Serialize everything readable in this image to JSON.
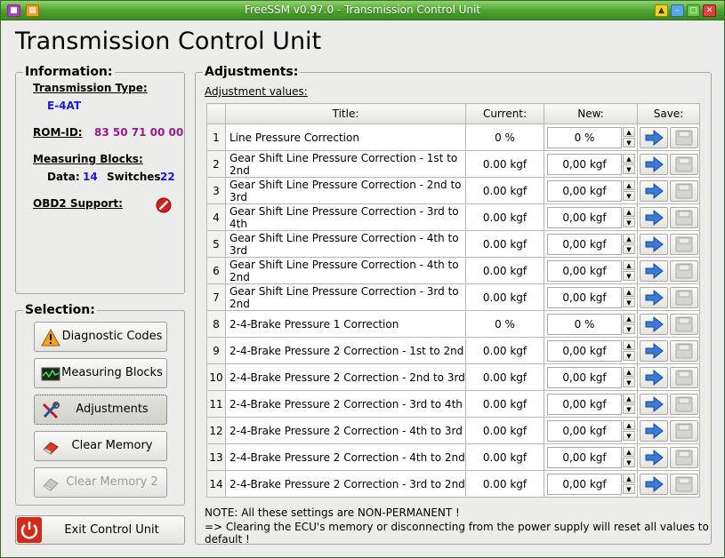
{
  "window": {
    "title": "FreeSSM v0.97.0 - Transmission Control Unit"
  },
  "header": {
    "title": "Transmission Control Unit"
  },
  "info": {
    "legend": "Information:",
    "trans_type_label": "Transmission Type:",
    "trans_type_value": "E-4AT",
    "romid_label": "ROM-ID:",
    "romid_value": "83 50 71 00 00",
    "mb_label": "Measuring Blocks:",
    "data_label": "Data:",
    "data_value": "14",
    "switches_label": "Switches",
    "switches_value": "22",
    "obd2_label": "OBD2 Support:"
  },
  "selection": {
    "legend": "Selection:",
    "buttons": [
      {
        "label": "Diagnostic Codes"
      },
      {
        "label": "Measuring Blocks"
      },
      {
        "label": "Adjustments"
      },
      {
        "label": "Clear Memory"
      },
      {
        "label": "Clear Memory 2"
      }
    ],
    "exit_label": "Exit Control Unit"
  },
  "adjustments": {
    "legend": "Adjustments:",
    "sub_label": "Adjustment values:",
    "headers": {
      "title": "Title:",
      "current": "Current:",
      "new": "New:",
      "save": "Save:"
    },
    "rows": [
      {
        "n": "1",
        "title": "Line Pressure Correction",
        "current": "0 %",
        "new": "0 %"
      },
      {
        "n": "2",
        "title": "Gear Shift Line Pressure Correction - 1st to 2nd",
        "current": "0.00 kgf",
        "new": "0,00 kgf"
      },
      {
        "n": "3",
        "title": "Gear Shift Line Pressure Correction - 2nd to 3rd",
        "current": "0.00 kgf",
        "new": "0,00 kgf"
      },
      {
        "n": "4",
        "title": "Gear Shift Line Pressure Correction - 3rd to 4th",
        "current": "0.00 kgf",
        "new": "0,00 kgf"
      },
      {
        "n": "5",
        "title": "Gear Shift Line Pressure Correction - 4th to 3rd",
        "current": "0.00 kgf",
        "new": "0,00 kgf"
      },
      {
        "n": "6",
        "title": "Gear Shift Line Pressure Correction - 4th to 2nd",
        "current": "0.00 kgf",
        "new": "0,00 kgf"
      },
      {
        "n": "7",
        "title": "Gear Shift Line Pressure Correction - 3rd to 2nd",
        "current": "0.00 kgf",
        "new": "0,00 kgf"
      },
      {
        "n": "8",
        "title": "2-4-Brake Pressure 1 Correction",
        "current": "0 %",
        "new": "0 %"
      },
      {
        "n": "9",
        "title": "2-4-Brake Pressure 2 Correction - 1st to 2nd",
        "current": "0.00 kgf",
        "new": "0,00 kgf"
      },
      {
        "n": "10",
        "title": "2-4-Brake Pressure 2 Correction - 2nd to 3rd",
        "current": "0.00 kgf",
        "new": "0,00 kgf"
      },
      {
        "n": "11",
        "title": "2-4-Brake Pressure 2 Correction - 3rd to 4th",
        "current": "0.00 kgf",
        "new": "0,00 kgf"
      },
      {
        "n": "12",
        "title": "2-4-Brake Pressure 2 Correction - 4th to 3rd",
        "current": "0.00 kgf",
        "new": "0,00 kgf"
      },
      {
        "n": "13",
        "title": "2-4-Brake Pressure 2 Correction - 4th to 2nd",
        "current": "0.00 kgf",
        "new": "0,00 kgf"
      },
      {
        "n": "14",
        "title": "2-4-Brake Pressure 2 Correction - 3rd to 2nd",
        "current": "0.00 kgf",
        "new": "0,00 kgf"
      }
    ],
    "note1": "NOTE:  All these settings are NON-PERMANENT !",
    "note2": "=> Clearing the ECU's memory or disconnecting from the power supply will reset all values to default !"
  }
}
